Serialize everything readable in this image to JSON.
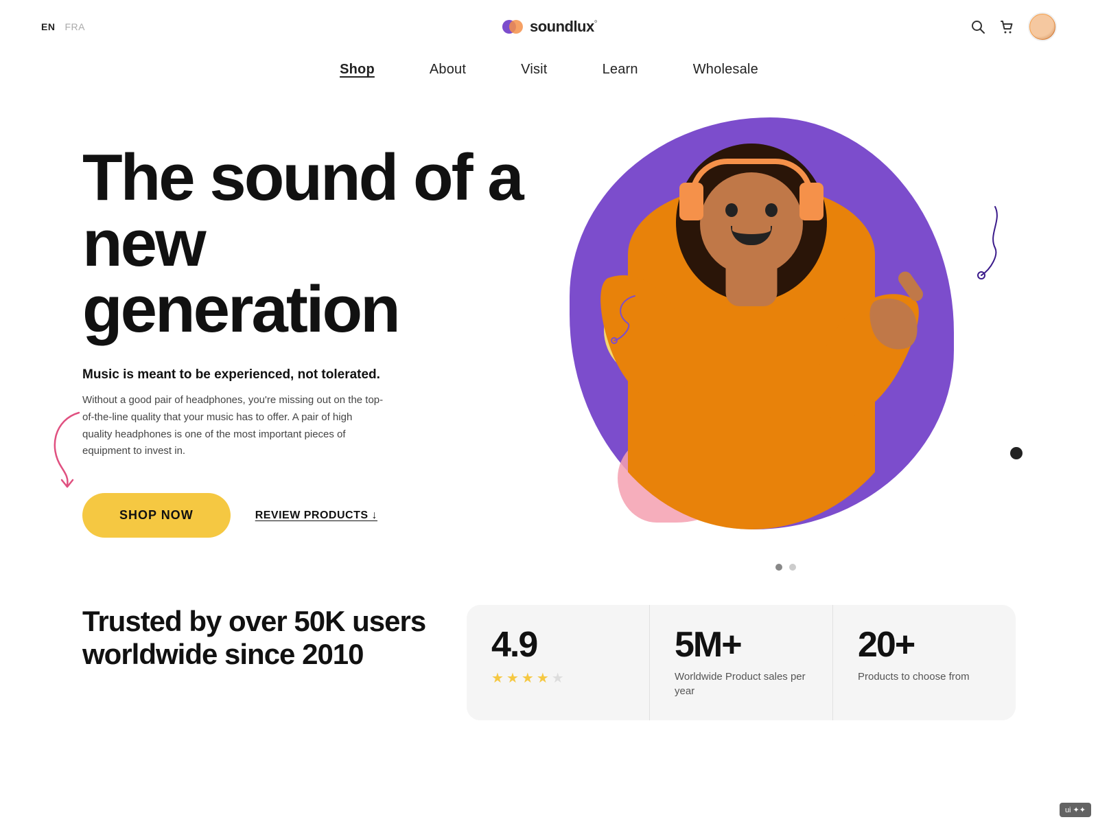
{
  "header": {
    "lang_en": "EN",
    "lang_fra": "FRA",
    "logo_text": "soundlux",
    "logo_super": "°"
  },
  "nav": {
    "items": [
      {
        "label": "Shop",
        "active": true
      },
      {
        "label": "About",
        "active": false
      },
      {
        "label": "Visit",
        "active": false
      },
      {
        "label": "Learn",
        "active": false
      },
      {
        "label": "Wholesale",
        "active": false
      }
    ]
  },
  "hero": {
    "title": "The sound of a new generation",
    "subtitle": "Music is meant to be experienced, not tolerated.",
    "description": "Without a good pair of headphones, you're missing out on the top-of-the-line quality that your music has to offer. A pair of high quality headphones is one of the most important pieces of equipment to invest in.",
    "btn_shop": "SHOP NOW",
    "btn_review": "REVIEW PRODUCTS ↓"
  },
  "stats": {
    "left_title": "Trusted by over 50K users worldwide since 2010",
    "cards": [
      {
        "number": "4.9",
        "stars": 4.5,
        "label": ""
      },
      {
        "number": "5M+",
        "label": "Worldwide Product sales per year"
      },
      {
        "number": "20+",
        "label": "Products to choose from"
      }
    ]
  }
}
